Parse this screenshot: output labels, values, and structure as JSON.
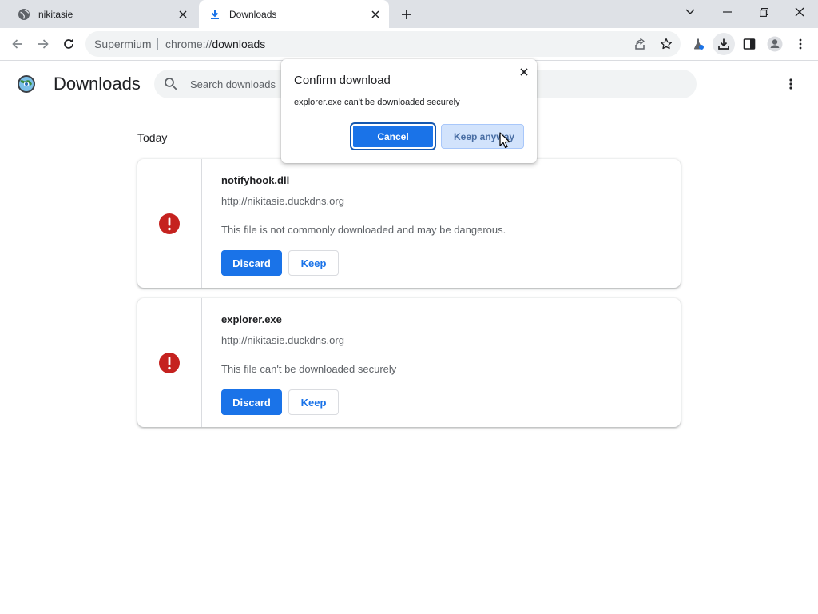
{
  "tabs": [
    {
      "title": "nikitasie",
      "icon": "globe-icon",
      "active": false
    },
    {
      "title": "Downloads",
      "icon": "download-icon",
      "active": true
    }
  ],
  "toolbar": {
    "omnibox": {
      "site_label": "Supermium",
      "url_prefix": "chrome://",
      "url_host": "downloads"
    }
  },
  "page": {
    "title": "Downloads",
    "search": {
      "placeholder": "Search downloads",
      "value": ""
    },
    "section_date": "Today"
  },
  "downloads": [
    {
      "filename": "notifyhook.dll",
      "url": "http://nikitasie.duckdns.org",
      "description": "This file is not commonly downloaded and may be dangerous.",
      "discard_label": "Discard",
      "keep_label": "Keep"
    },
    {
      "filename": "explorer.exe",
      "url": "http://nikitasie.duckdns.org",
      "description": "This file can't be downloaded securely",
      "discard_label": "Discard",
      "keep_label": "Keep"
    }
  ],
  "dialog": {
    "title": "Confirm download",
    "message": "explorer.exe can't be downloaded securely",
    "cancel_label": "Cancel",
    "keep_label": "Keep anyway"
  },
  "colors": {
    "accent": "#1a73e8",
    "warning": "#c5221f",
    "tabstrip": "#dee1e6",
    "omnibox": "#f1f3f4"
  }
}
